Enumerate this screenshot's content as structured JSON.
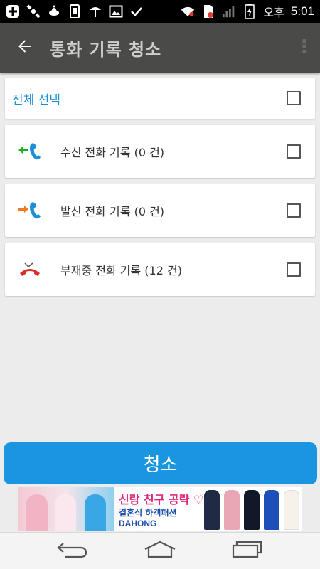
{
  "status_bar": {
    "ampm": "오후",
    "time": "5:01",
    "icons": [
      "add-icon",
      "satellite-icon",
      "alien-icon",
      "sim-icon",
      "umbrella-icon",
      "image-icon",
      "check-icon",
      "wifi-icon",
      "sim-card-icon",
      "signal-icon",
      "battery-icon"
    ]
  },
  "toolbar": {
    "title": "통화 기록 청소",
    "back_icon": "back-arrow-icon",
    "overflow_icon": "more-vert-icon"
  },
  "select_all": {
    "label": "전체 선택",
    "checked": false
  },
  "rows": [
    {
      "label": "수신 전화 기록 (0 건)",
      "icon": "incoming-call-icon",
      "checked": false
    },
    {
      "label": "발신 전화 기록 (0 건)",
      "icon": "outgoing-call-icon",
      "checked": false
    },
    {
      "label": "부재중 전화 기록 (12 건)",
      "icon": "missed-call-icon",
      "checked": false
    }
  ],
  "clear_button": {
    "label": "청소"
  },
  "ad": {
    "title": "신랑 친구 공략 ♡",
    "subtitle": "결혼식 하객패션",
    "brand": "DAHONG"
  },
  "nav": {
    "back_icon": "nav-back-icon",
    "home_icon": "nav-home-icon",
    "recents_icon": "nav-recents-icon"
  },
  "colors": {
    "toolbar": "#4a4a48",
    "accent": "#1a95e0",
    "select_label": "#1a8fd8"
  }
}
